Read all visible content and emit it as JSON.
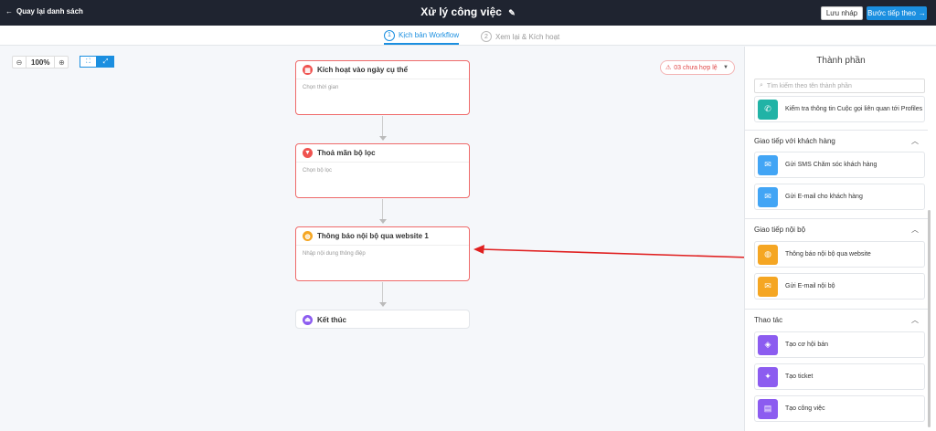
{
  "header": {
    "back_label": "Quay lại danh sách",
    "title": "Xử lý công việc",
    "save_draft": "Lưu nháp",
    "next_step": "Bước tiếp theo"
  },
  "steps": [
    {
      "num": "1",
      "label": "Kịch bản Workflow"
    },
    {
      "num": "2",
      "label": "Xem lại & Kích hoạt"
    }
  ],
  "canvas": {
    "zoom": "100%",
    "alert_text": "03 chưa hợp lệ",
    "nodes": [
      {
        "title": "Kích hoạt vào ngày cụ thể",
        "hint": "Chọn thời gian",
        "color": "#ef5350"
      },
      {
        "title": "Thoả mãn bộ lọc",
        "hint": "Chọn bộ lọc",
        "color": "#ef5350"
      },
      {
        "title": "Thông báo nội bộ qua website 1",
        "hint": "Nhập nội dung thông điệp",
        "color": "#f5a623"
      },
      {
        "title": "Kết thúc",
        "hint": "",
        "color": "#8c5cf0"
      }
    ]
  },
  "panel": {
    "title": "Thành phần",
    "search_placeholder": "Tìm kiếm theo tên thành phần",
    "top_item": {
      "label": "Kiểm tra thông tin Cuộc gọi liên quan tới Profiles",
      "color": "#21b3a6"
    },
    "sections": [
      {
        "name": "Giao tiếp với khách hàng",
        "items": [
          {
            "label": "Gửi SMS Chăm sóc khách hàng",
            "color": "#42a5f5"
          },
          {
            "label": "Gửi E-mail cho khách hàng",
            "color": "#42a5f5"
          }
        ]
      },
      {
        "name": "Giao tiếp nội bộ",
        "items": [
          {
            "label": "Thông báo nội bộ qua website",
            "color": "#f5a623"
          },
          {
            "label": "Gửi E-mail nội bộ",
            "color": "#f5a623"
          }
        ]
      },
      {
        "name": "Thao tác",
        "items": [
          {
            "label": "Tạo cơ hội bán",
            "color": "#8c5cf0"
          },
          {
            "label": "Tạo ticket",
            "color": "#8c5cf0"
          },
          {
            "label": "Tạo công việc",
            "color": "#8c5cf0"
          }
        ]
      }
    ]
  }
}
